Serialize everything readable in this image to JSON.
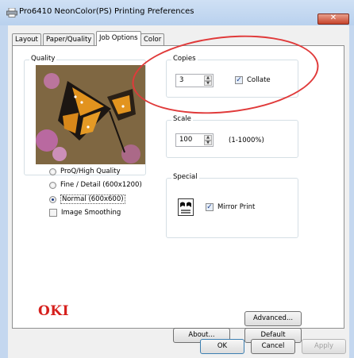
{
  "window": {
    "title": "Pro6410 NeonColor(PS) Printing Preferences",
    "close_label": "✕"
  },
  "tabs": [
    {
      "label": "Layout"
    },
    {
      "label": "Paper/Quality"
    },
    {
      "label": "Job Options",
      "active": true
    },
    {
      "label": "Color"
    }
  ],
  "quality": {
    "label": "Quality",
    "preview_icon": "butterfly-photo",
    "options": [
      {
        "label": "ProQ/High Quality",
        "checked": false
      },
      {
        "label": "Fine / Detail (600x1200)",
        "checked": false
      },
      {
        "label": "Normal (600x600)",
        "checked": true
      }
    ],
    "image_smoothing": {
      "label": "Image Smoothing",
      "checked": false
    }
  },
  "copies": {
    "label": "Copies",
    "value": "3",
    "collate": {
      "label": "Collate",
      "checked": true
    }
  },
  "scale": {
    "label": "Scale",
    "value": "100",
    "range_hint": "(1-1000%)"
  },
  "special": {
    "label": "Special",
    "icon": "mirror-print-icon",
    "mirror_print": {
      "label": "Mirror Print",
      "checked": true
    }
  },
  "buttons": {
    "advanced": "Advanced...",
    "about": "About...",
    "default": "Default",
    "ok": "OK",
    "cancel": "Cancel",
    "apply": "Apply"
  },
  "brand": {
    "logo_text": "OKI",
    "color": "#d6201d"
  },
  "colors": {
    "annotation_circle": "#e03a3a",
    "title_bar": "#b9d1ee",
    "close_button": "#c7432b"
  }
}
